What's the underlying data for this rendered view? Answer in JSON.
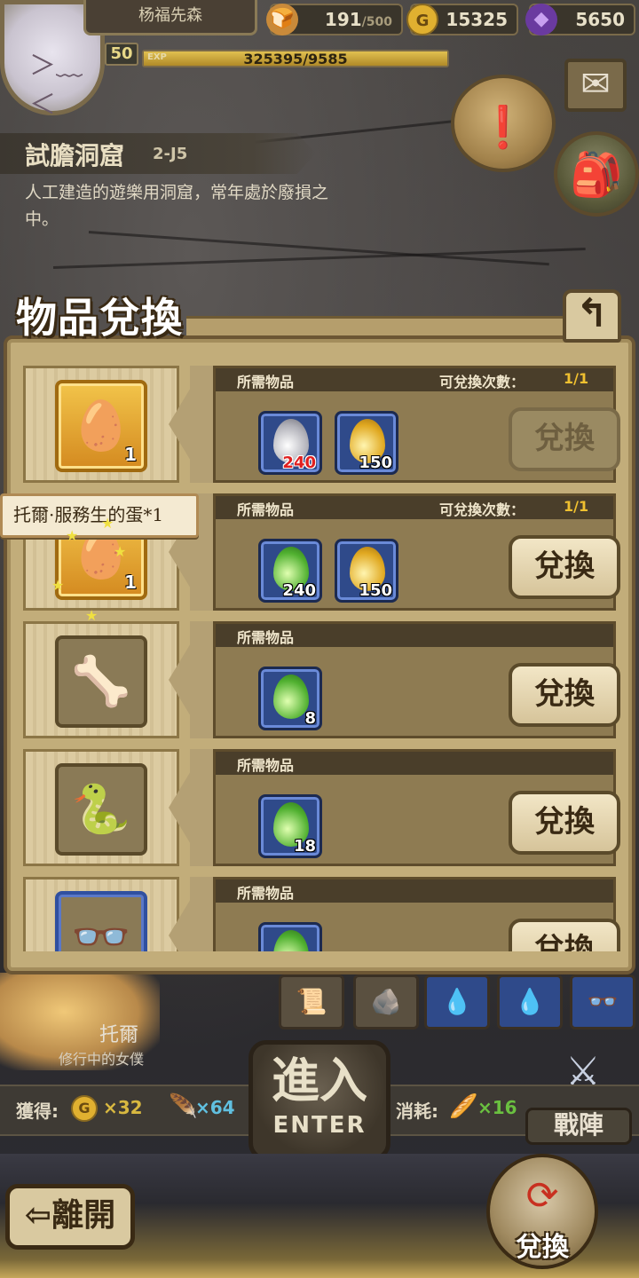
{
  "player": {
    "name": "杨福先森",
    "level": "50",
    "exp_label": "EXP",
    "exp_text": "325395/9585",
    "exp_fraction": 1.0
  },
  "resources": {
    "stamina": {
      "value": "191",
      "max": "/500",
      "icon": "bread-icon"
    },
    "gold": {
      "value": "15325",
      "icon": "gold-coin-icon",
      "symbol": "G"
    },
    "gems": {
      "value": "5650",
      "icon": "purple-gem-icon"
    }
  },
  "stage": {
    "name": "試膽洞窟",
    "code": "2-J5",
    "description": "人工建造的遊樂用洞窟，常年處於廢損之中。"
  },
  "panel": {
    "title": "物品兌換",
    "back_icon": "return-arrow-icon",
    "required_label": "所需物品",
    "count_label": "可兌換次數："
  },
  "exchange_items": [
    {
      "reward_icon": "pink-egg-icon",
      "reward_qty": "1",
      "frame": "gold",
      "count": "1/1",
      "button": "兌換",
      "enabled": false,
      "materials": [
        {
          "color": "silver",
          "amount": "240",
          "insufficient": true
        },
        {
          "color": "gold",
          "amount": "150",
          "insufficient": false
        }
      ]
    },
    {
      "reward_icon": "green-egg-icon",
      "reward_qty": "1",
      "frame": "gold",
      "count": "1/1",
      "button": "兌換",
      "enabled": true,
      "materials": [
        {
          "color": "green",
          "amount": "240",
          "insufficient": false
        },
        {
          "color": "gold",
          "amount": "150",
          "insufficient": false
        }
      ]
    },
    {
      "reward_icon": "claw-icon",
      "reward_qty": "",
      "frame": "plain",
      "count": "",
      "button": "兌換",
      "enabled": true,
      "materials": [
        {
          "color": "green",
          "amount": "8",
          "insufficient": false
        }
      ]
    },
    {
      "reward_icon": "tail-icon",
      "reward_qty": "",
      "frame": "plain",
      "count": "",
      "button": "兌換",
      "enabled": true,
      "materials": [
        {
          "color": "green",
          "amount": "18",
          "insufficient": false
        }
      ]
    },
    {
      "reward_icon": "glasses-icon",
      "reward_qty": "",
      "frame": "blue",
      "count": "",
      "button": "兌換",
      "enabled": true,
      "materials": [
        {
          "color": "green",
          "amount": "",
          "insufficient": false
        }
      ]
    }
  ],
  "tooltip": {
    "text": "托爾·服務生的蛋*1"
  },
  "hero": {
    "name": "托爾",
    "title": "修行中的女僕"
  },
  "rewards_bar": {
    "gain_label": "獲得:",
    "gold": "×32",
    "exp": "×64",
    "cost_label": "消耗:",
    "cost": "×16"
  },
  "enter": {
    "main": "進入",
    "sub": "ENTER"
  },
  "formation": {
    "label": "戰陣"
  },
  "leave": {
    "label": "離開"
  },
  "exchange_button": {
    "label": "兌換"
  }
}
